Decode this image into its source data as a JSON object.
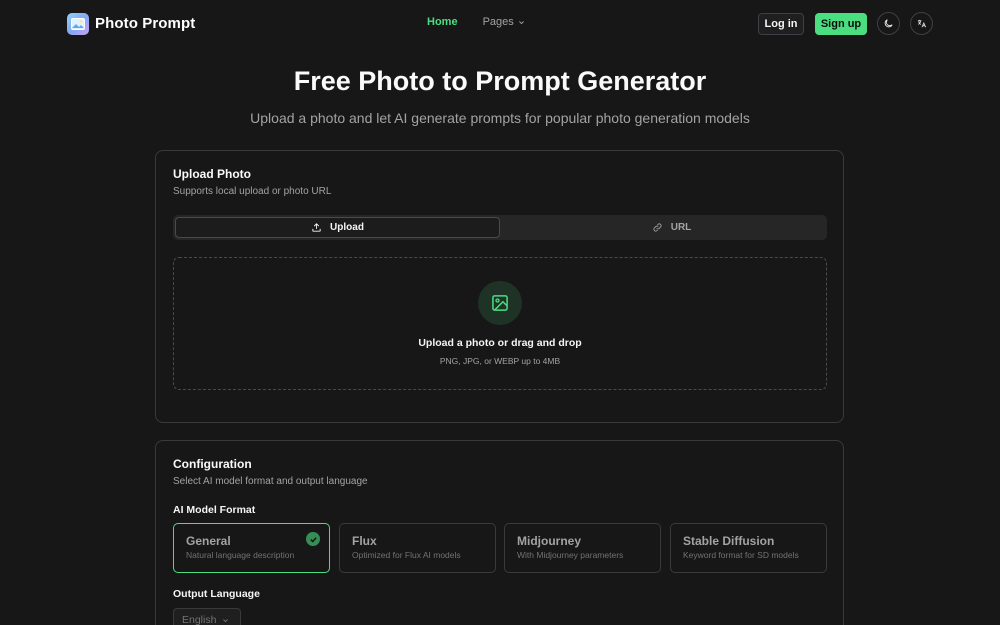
{
  "header": {
    "brand": "Photo Prompt",
    "nav": {
      "home": "Home",
      "pages": "Pages"
    },
    "login": "Log in",
    "signup": "Sign up",
    "theme_icon": "moon-icon",
    "language_icon": "translate-icon"
  },
  "hero": {
    "title": "Free Photo to Prompt Generator",
    "subtitle": "Upload a photo and let AI generate prompts for popular photo generation models"
  },
  "upload_card": {
    "title": "Upload Photo",
    "description": "Supports local upload or photo URL",
    "tabs": [
      {
        "label": "Upload",
        "icon": "upload-icon",
        "active": true
      },
      {
        "label": "URL",
        "icon": "link-icon",
        "active": false
      }
    ],
    "dropzone": {
      "icon": "image-icon",
      "title": "Upload a photo or drag and drop",
      "hint": "PNG, JPG, or WEBP up to 4MB"
    }
  },
  "config_card": {
    "title": "Configuration",
    "description": "Select AI model format and output language",
    "model_label": "AI Model Format",
    "models": [
      {
        "name": "General",
        "desc": "Natural language description",
        "selected": true
      },
      {
        "name": "Flux",
        "desc": "Optimized for Flux AI models",
        "selected": false
      },
      {
        "name": "Midjourney",
        "desc": "With Midjourney parameters",
        "selected": false
      },
      {
        "name": "Stable Diffusion",
        "desc": "Keyword format for SD models",
        "selected": false
      }
    ],
    "language_label": "Output Language",
    "language_value": "English"
  },
  "colors": {
    "background": "#171717",
    "accent": "#4ade80",
    "border": "#3a3a3a"
  }
}
